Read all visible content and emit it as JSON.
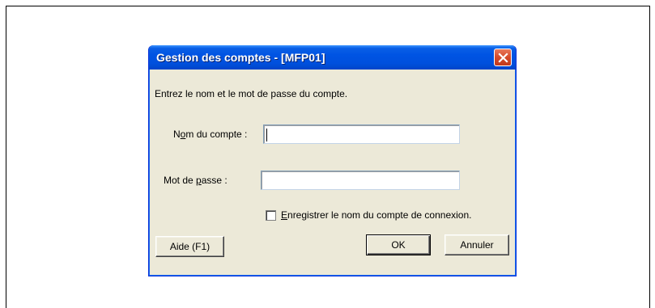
{
  "dialog": {
    "title": "Gestion des comptes - [MFP01]",
    "prompt": "Entrez le nom et le mot de passe du compte.",
    "account_name_label_pre": "N",
    "account_name_label_key": "o",
    "account_name_label_post": "m du compte :",
    "account_name_value": "",
    "password_label_pre": "Mot de ",
    "password_label_key": "p",
    "password_label_post": "asse :",
    "password_value": "",
    "save_checkbox_checked": false,
    "save_checkbox_label_key": "E",
    "save_checkbox_label_rest": "nregistrer le nom du compte de connexion.",
    "help_button": "Aide (F1)",
    "ok_button": "OK",
    "cancel_button": "Annuler"
  },
  "colors": {
    "titlebar": "#0054e3",
    "dialog_bg": "#ece9d8",
    "close_button": "#d54a2a"
  }
}
